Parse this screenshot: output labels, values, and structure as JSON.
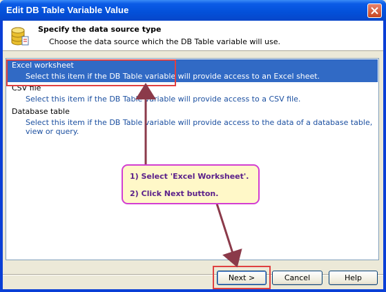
{
  "window": {
    "title": "Edit DB Table Variable Value"
  },
  "header": {
    "title": "Specify the data source type",
    "subtitle": "Choose the data source which the DB Table variable will use."
  },
  "list": {
    "items": [
      {
        "label": "Excel worksheet",
        "description": "Select this item if the DB Table variable will provide access to an Excel sheet.",
        "selected": true
      },
      {
        "label": "CSV file",
        "description": "Select this item if the DB Table variable will provide access to a CSV file.",
        "selected": false
      },
      {
        "label": "Database table",
        "description": "Select this item if the DB Table variable will provide access to the data of a database table, view or query.",
        "selected": false
      }
    ]
  },
  "callout": {
    "line1": "1) Select 'Excel Worksheet'.",
    "line2": "2) Click Next button."
  },
  "buttons": {
    "next": "Next >",
    "cancel": "Cancel",
    "help": "Help"
  },
  "colors": {
    "selection": "#316ac5",
    "annotation_red": "#e04040",
    "callout_border": "#d23ed2",
    "arrow": "#8b3a4a"
  },
  "icons": {
    "header": "database-wizard-icon",
    "close": "close-icon"
  }
}
